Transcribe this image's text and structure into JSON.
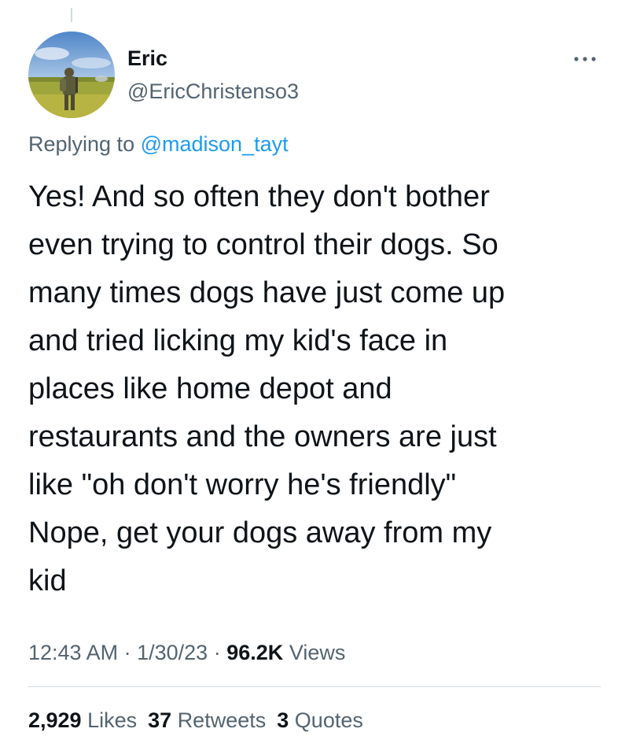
{
  "tweet": {
    "author": {
      "display_name": "Eric",
      "handle": "@EricChristenso3"
    },
    "more_icon": "more-horizontal-icon",
    "replying_prefix": "Replying to",
    "replying_to": "@madison_tayt",
    "text": "Yes! And so often they don't bother\neven trying to control their dogs. So\nmany times dogs have just come up\nand tried licking my kid's face in\nplaces like home depot and\nrestaurants and the owners are just\nlike \"oh don't worry he's friendly\"\nNope, get your dogs away from my\nkid",
    "time": "12:43 AM",
    "separator": "·",
    "date": "1/30/23",
    "views_count": "96.2K",
    "views_label": "Views",
    "stats": {
      "likes_count": "2,929",
      "likes_label": "Likes",
      "retweets_count": "37",
      "retweets_label": "Retweets",
      "quotes_count": "3",
      "quotes_label": "Quotes"
    }
  },
  "colors": {
    "text": "#0f1419",
    "secondary": "#536471",
    "link": "#1d9bf0",
    "divider": "#cfd9de"
  }
}
